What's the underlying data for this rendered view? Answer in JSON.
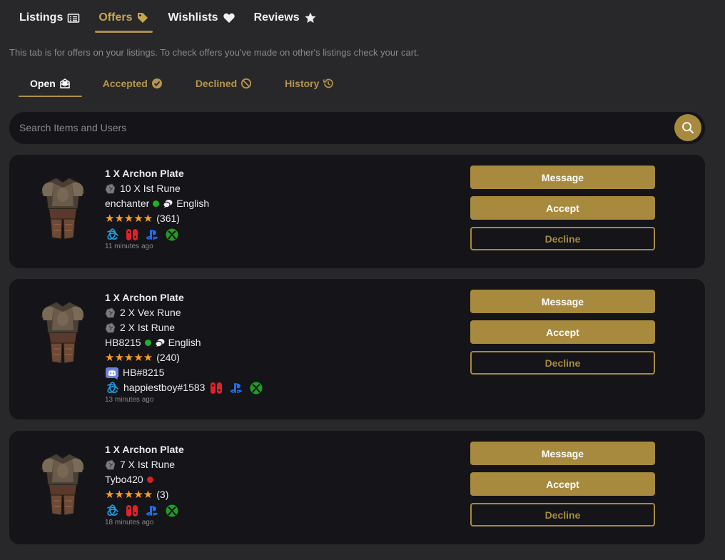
{
  "tabs": [
    {
      "label": "Listings",
      "icon": "list-icon"
    },
    {
      "label": "Offers",
      "icon": "tag-icon"
    },
    {
      "label": "Wishlists",
      "icon": "heart-icon"
    },
    {
      "label": "Reviews",
      "icon": "star-icon"
    }
  ],
  "info_text": "This tab is for offers on your listings. To check offers you've made on other's listings check your cart.",
  "subtabs": [
    {
      "label": "Open",
      "icon": "envelope-icon"
    },
    {
      "label": "Accepted",
      "icon": "check-circle-icon"
    },
    {
      "label": "Declined",
      "icon": "ban-icon"
    },
    {
      "label": "History",
      "icon": "history-icon"
    }
  ],
  "search": {
    "placeholder": "Search Items and Users",
    "icon": "search-icon"
  },
  "buttons": {
    "message": "Message",
    "accept": "Accept",
    "decline": "Decline"
  },
  "colors": {
    "accent": "#a88a3e",
    "background": "#28282a",
    "card": "#141419",
    "online": "#1db32a",
    "offline": "#d91f26",
    "stars": "#ff9e1b"
  },
  "offers": [
    {
      "title": "1 X Archon Plate",
      "runes": [
        "10 X Ist Rune"
      ],
      "user": "enchanter",
      "status": "online",
      "language": "English",
      "stars": "★★★★★",
      "rating_count": "(361)",
      "discord": "",
      "platform_user": "",
      "time": "11 minutes ago"
    },
    {
      "title": "1 X Archon Plate",
      "runes": [
        "2 X Vex Rune",
        "2 X Ist Rune"
      ],
      "user": "HB8215",
      "status": "online",
      "language": "English",
      "stars": "★★★★★",
      "rating_count": "(240)",
      "discord": "HB#8215",
      "platform_user": "happiestboy#1583",
      "time": "13 minutes ago"
    },
    {
      "title": "1 X Archon Plate",
      "runes": [
        "7 X Ist Rune"
      ],
      "user": "Tybo420",
      "status": "offline",
      "language": "",
      "stars": "★★★★★",
      "rating_count": "(3)",
      "discord": "",
      "platform_user": "",
      "time": "18 minutes ago"
    }
  ]
}
